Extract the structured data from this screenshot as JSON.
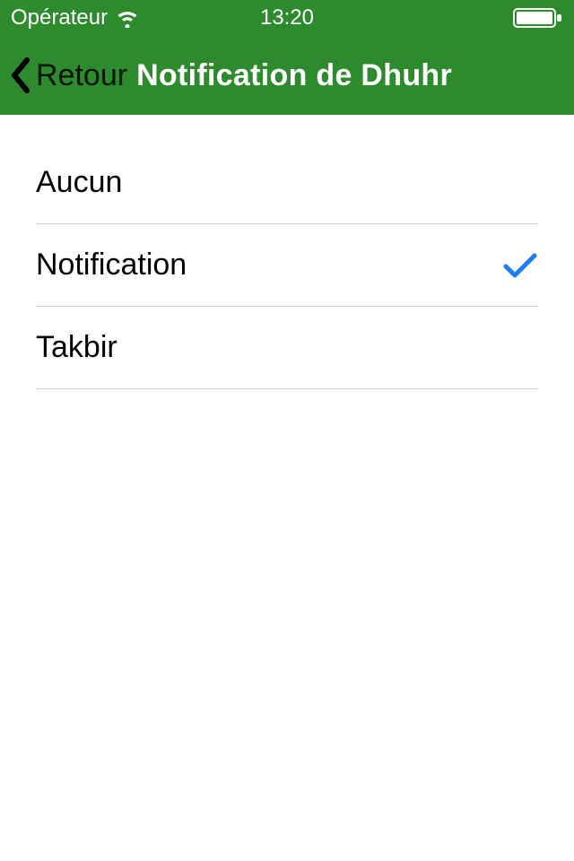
{
  "statusBar": {
    "carrier": "Opérateur",
    "time": "13:20"
  },
  "navBar": {
    "backLabel": "Retour",
    "title": "Notification de Dhuhr"
  },
  "options": [
    {
      "label": "Aucun",
      "selected": false
    },
    {
      "label": "Notification",
      "selected": true
    },
    {
      "label": "Takbir",
      "selected": false
    }
  ],
  "colors": {
    "headerGreen": "#2d8a2d",
    "checkBlue": "#1e7cf2"
  }
}
